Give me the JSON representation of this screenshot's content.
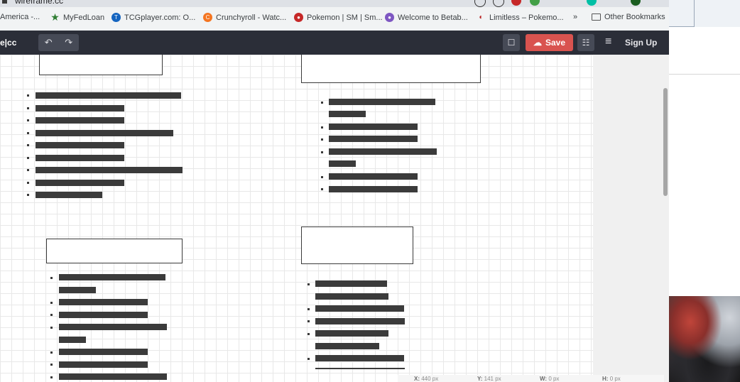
{
  "browser": {
    "tab_title": "wireframe.cc",
    "bookmarks": [
      {
        "label": "America -...",
        "icon": "bank-icon",
        "color": "#c0392b"
      },
      {
        "label": "MyFedLoan",
        "icon": "star-icon",
        "color": "#2e7d32"
      },
      {
        "label": "TCGplayer.com: O...",
        "icon": "tcgplayer-icon",
        "color": "#1565c0"
      },
      {
        "label": "Crunchyroll - Watc...",
        "icon": "crunchyroll-icon",
        "color": "#f47521"
      },
      {
        "label": "Pokemon | SM | Sm...",
        "icon": "pokeball-icon",
        "color": "#c62828"
      },
      {
        "label": "Welcome to Betab...",
        "icon": "betaball-icon",
        "color": "#7e57c2"
      },
      {
        "label": "Limitless – Pokemo...",
        "icon": "limitless-icon",
        "color": "#b71c1c"
      }
    ],
    "overflow_label": "»",
    "other_bookmarks": "Other Bookmarks"
  },
  "app": {
    "logo": "e|cc",
    "undo_glyph": "↶",
    "redo_glyph": "↷",
    "comment_glyph": "☐",
    "save_label": "Save",
    "settings_glyph": "☷",
    "menu_glyph": "≡",
    "signup_label": "Sign Up"
  },
  "status": {
    "x_label": "X:",
    "x_value": "440 px",
    "y_label": "Y:",
    "y_value": "141 px",
    "w_label": "W:",
    "w_value": "0 px",
    "h_label": "H:",
    "h_value": "0 px"
  }
}
